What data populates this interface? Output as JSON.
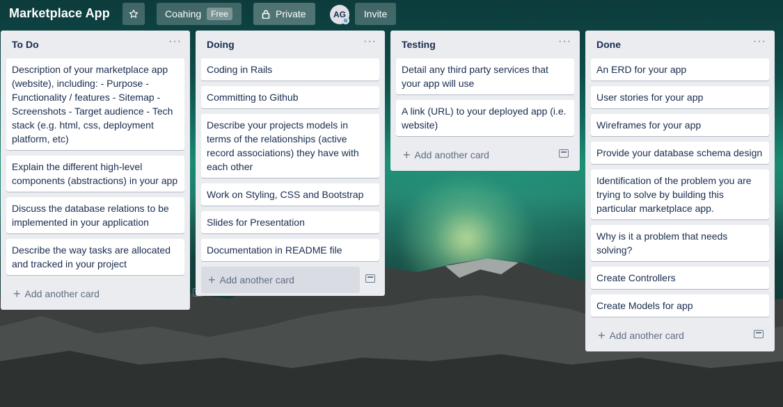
{
  "board": {
    "title": "Marketplace App",
    "team_name": "Coahing",
    "team_badge": "Free",
    "visibility": "Private",
    "avatar_initials": "AG",
    "invite_label": "Invite"
  },
  "add_card_label": "Add another card",
  "icons": {
    "star": "star-icon",
    "lock": "lock-icon",
    "menu": "more-horizontal-icon",
    "plus": "plus-icon",
    "template": "card-template-icon"
  },
  "lists": [
    {
      "title": "To Do",
      "cards": [
        "Description of your marketplace app (website), including: - Purpose - Functionality / features - Sitemap - Screenshots - Target audience - Tech stack (e.g. html, css, deployment platform, etc)",
        "Explain the different high-level components (abstractions) in your app",
        "Discuss the database relations to be implemented in your application",
        "Describe the way tasks are allocated and tracked in your project"
      ]
    },
    {
      "title": "Doing",
      "cards": [
        "Coding in Rails",
        "Committing to Github",
        "Describe your projects models in terms of the relationships (active record associations) they have with each other",
        "Work on Styling, CSS and Bootstrap",
        "Slides for Presentation",
        "Documentation in README file"
      ]
    },
    {
      "title": "Testing",
      "cards": [
        "Detail any third party services that your app will use",
        "A link (URL) to your deployed app (i.e. website)"
      ]
    },
    {
      "title": "Done",
      "cards": [
        "An ERD for your app",
        "User stories for your app",
        "Wireframes for your app",
        "Provide your database schema design",
        "Identification of the problem you are trying to solve by building this particular marketplace app.",
        "Why is it a problem that needs solving?",
        "Create Controllers",
        "Create Models for app"
      ]
    }
  ]
}
